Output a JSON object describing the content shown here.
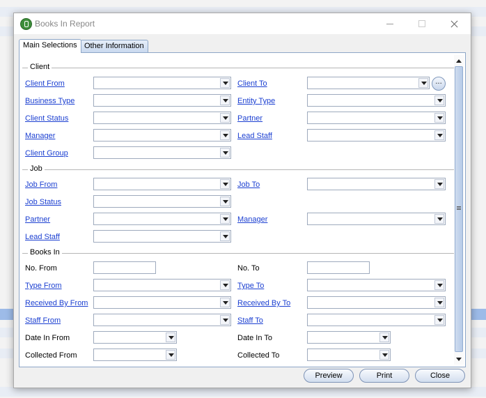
{
  "window": {
    "title": "Books In Report"
  },
  "tabs": [
    {
      "label": "Main Selections",
      "active": true
    },
    {
      "label": "Other Information",
      "active": false
    }
  ],
  "groups": {
    "client": "Client",
    "job": "Job",
    "books_in": "Books In"
  },
  "fields": {
    "client_from": "Client From",
    "client_to": "Client To",
    "business_type": "Business Type",
    "entity_type": "Entity Type",
    "client_status": "Client Status",
    "client_partner": "Partner",
    "client_manager": "Manager",
    "client_lead_staff": "Lead Staff",
    "client_group": "Client Group",
    "job_from": "Job From",
    "job_to": "Job To",
    "job_status": "Job Status",
    "job_partner": "Partner",
    "job_manager": "Manager",
    "job_lead_staff": "Lead Staff",
    "no_from": "No. From",
    "no_to": "No. To",
    "type_from": "Type From",
    "type_to": "Type To",
    "received_by_from": "Received By From",
    "received_by_to": "Received By To",
    "staff_from": "Staff From",
    "staff_to": "Staff To",
    "date_in_from": "Date In From",
    "date_in_to": "Date In To",
    "collected_from": "Collected From",
    "collected_to": "Collected To"
  },
  "ellipsis_label": "...",
  "buttons": {
    "preview": "Preview",
    "print": "Print",
    "close": "Close"
  },
  "colors": {
    "link": "#1b3fd1",
    "app_icon": "#3d8d3b",
    "tab_border": "#8da6c7"
  }
}
